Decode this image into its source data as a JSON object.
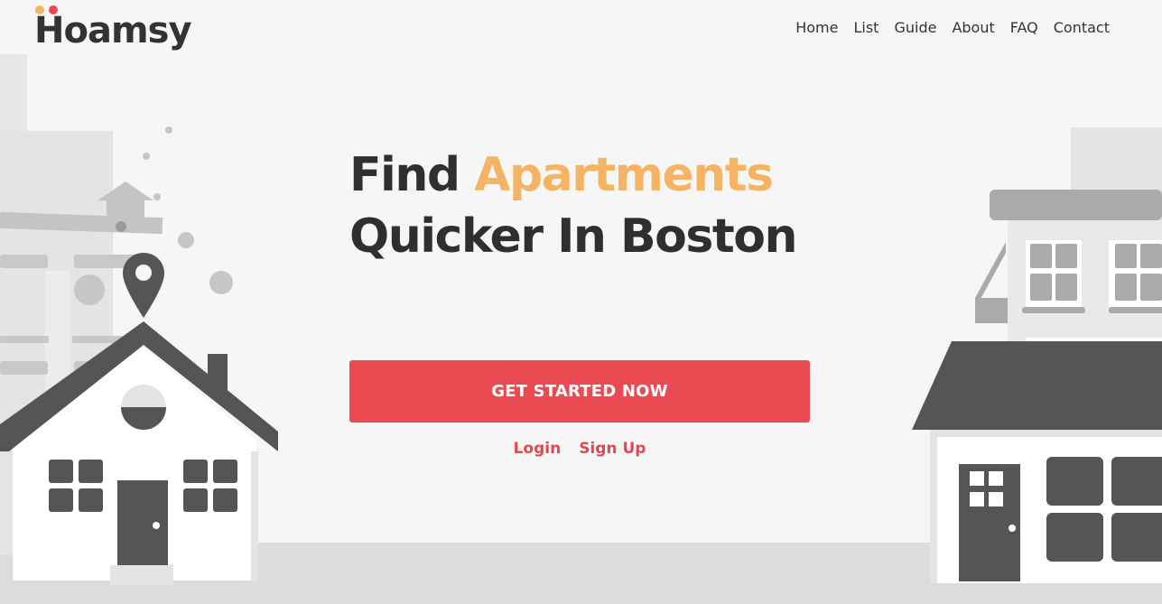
{
  "brand": {
    "name": "Hoamsy",
    "dot_colors": [
      "#f5b463",
      "#ea4a52"
    ]
  },
  "nav": {
    "items": [
      {
        "label": "Home"
      },
      {
        "label": "List"
      },
      {
        "label": "Guide"
      },
      {
        "label": "About"
      },
      {
        "label": "FAQ"
      },
      {
        "label": "Contact"
      }
    ]
  },
  "hero": {
    "title_part1": "Find ",
    "title_accent": "Apartments",
    "title_line2": "Quicker In Boston",
    "cta_label": "GET STARTED NOW",
    "login_label": "Login",
    "signup_label": "Sign Up"
  },
  "colors": {
    "background": "#f6f6f6",
    "accent_orange": "#f5b463",
    "primary_red": "#ea4a52",
    "text_dark": "#2f2f2f",
    "illustration_dark": "#555555",
    "illustration_mid": "#aaaaaa",
    "illustration_light": "#e4e4e4"
  },
  "icons": {
    "map_pin": "map-pin-icon"
  }
}
